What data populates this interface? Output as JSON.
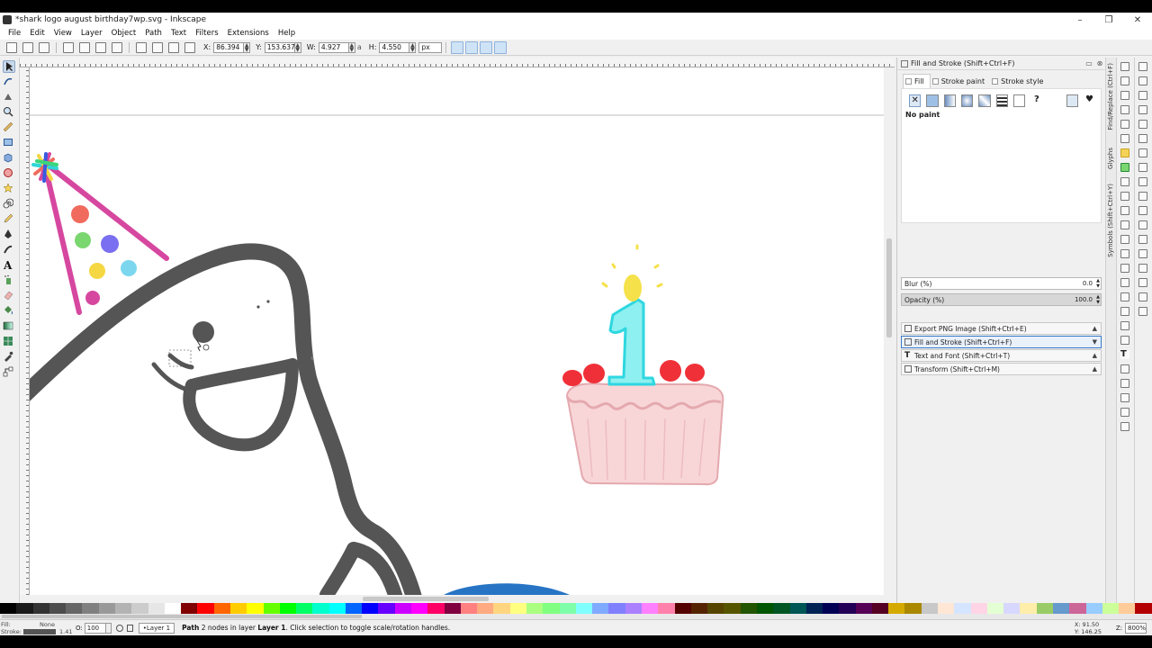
{
  "window": {
    "title": "*shark logo august birthday7wp.svg - Inkscape",
    "minimize": "–",
    "maximize": "❐",
    "close": "✕"
  },
  "menu": [
    "File",
    "Edit",
    "View",
    "Layer",
    "Object",
    "Path",
    "Text",
    "Filters",
    "Extensions",
    "Help"
  ],
  "tool_controls": {
    "x_label": "X:",
    "x_value": "86.394",
    "y_label": "Y:",
    "y_value": "153.637",
    "w_label": "W:",
    "w_value": "4.927",
    "h_label": "H:",
    "h_value": "4.550",
    "unit": "px",
    "lock_glyph": "a"
  },
  "dock": {
    "title": "Fill and Stroke (Shift+Ctrl+F)",
    "tabs": [
      "Fill",
      "Stroke paint",
      "Stroke style"
    ],
    "paint_buttons": [
      "✕",
      "",
      "",
      "",
      "",
      "",
      "",
      "?"
    ],
    "paint_status": "No paint",
    "blur_label": "Blur (%)",
    "blur_value": "0.0",
    "opacity_label": "Opacity (%)",
    "opacity_value": "100.0",
    "opacity_fraction": 1.0,
    "panels": [
      "Export PNG Image (Shift+Ctrl+E)",
      "Fill and Stroke (Shift+Ctrl+F)",
      "Text and Font (Shift+Ctrl+T)",
      "Transform (Shift+Ctrl+M)"
    ]
  },
  "side_tabs": [
    "Find/Replace (Ctrl+F)",
    "Glyphs",
    "Symbols (Shift+Ctrl+Y)"
  ],
  "statusbar": {
    "fill_label": "Fill:",
    "fill_value": "None",
    "stroke_label": "Stroke:",
    "stroke_width": "1.41",
    "opacity_label": "O:",
    "opacity_value": "100",
    "layer": "•Layer 1",
    "message_prefix": "Path",
    "message_body": " 2 nodes in layer ",
    "message_layer": "Layer 1",
    "message_tail": ". Click selection to toggle scale/rotation handles.",
    "coord_x": "X:    91.50",
    "coord_y": "Y:   146.25",
    "zoom_label": "Z:",
    "zoom_value": "800%"
  },
  "palette_colors": [
    "#000000",
    "#1a1a1a",
    "#333333",
    "#4d4d4d",
    "#666666",
    "#808080",
    "#999999",
    "#b3b3b3",
    "#cccccc",
    "#e6e6e6",
    "#ffffff",
    "#800000",
    "#ff0000",
    "#ff6600",
    "#ffcc00",
    "#ffff00",
    "#66ff00",
    "#00ff00",
    "#00ff66",
    "#00ffcc",
    "#00ffff",
    "#0066ff",
    "#0000ff",
    "#6600ff",
    "#cc00ff",
    "#ff00ff",
    "#ff0066",
    "#800040",
    "#ff8080",
    "#ffaa80",
    "#ffd580",
    "#ffff80",
    "#aaff80",
    "#80ff80",
    "#80ffaa",
    "#80ffff",
    "#80aaff",
    "#8080ff",
    "#aa80ff",
    "#ff80ff",
    "#ff80aa",
    "#550000",
    "#552200",
    "#554400",
    "#555500",
    "#225500",
    "#005500",
    "#005522",
    "#005555",
    "#002255",
    "#000055",
    "#220055",
    "#550055",
    "#550022",
    "#d4aa00",
    "#aa8800",
    "#c8c8c8",
    "#ffe6d5",
    "#d5e5ff",
    "#ffd5e5",
    "#e5ffd5",
    "#d7d7ff",
    "#ffeeaa",
    "#99cc66",
    "#6699cc",
    "#cc6699",
    "#99ccff",
    "#ccff99",
    "#ffcc99",
    "#b30000"
  ]
}
